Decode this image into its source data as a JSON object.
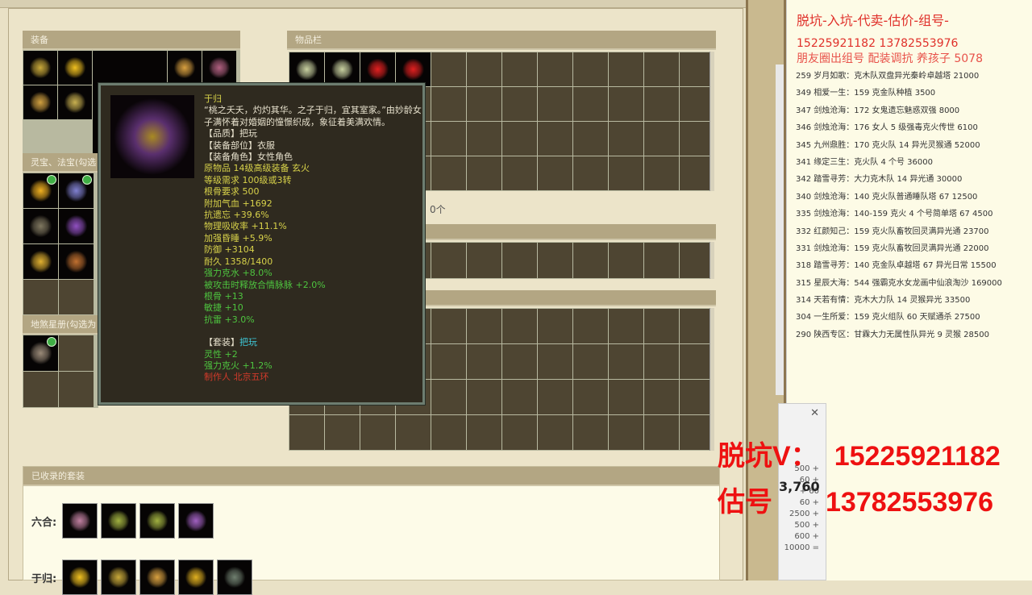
{
  "panels": {
    "equipment": "装备",
    "spirit_treasure": "灵宝、法宝(勾选",
    "star_book": "地煞星册(勾选为",
    "inventory": "物品栏",
    "count_text": "0个",
    "collected_sets": "已收录的套装"
  },
  "tooltip": {
    "name": "于归",
    "desc": "“桃之夭夭，灼灼其华。之子于归，宜其室家。”由妙龄女子满怀着对婚姻的憧憬织成，象征着美满欢情。",
    "quality": "【品质】把玩",
    "slot": "【装备部位】衣服",
    "role": "【装备角色】女性角色",
    "base_stats": [
      "原物品 14级高级装备 玄火",
      "等级需求 100级或3转",
      "根骨要求 500",
      "附加气血 +1692",
      "抗遗忘 +39.6%",
      "物理吸收率 +11.1%",
      "加强昏睡 +5.9%",
      "防御 +3104",
      "耐久 1358/1400"
    ],
    "extra_stats": [
      "强力克水 +8.0%",
      "被攻击时释放合情脉脉 +2.0%",
      "根骨 +13",
      "敏捷 +10",
      "抗雷 +3.0%"
    ],
    "set_label": "【套装】",
    "set_name": "把玩",
    "set_stats": [
      "灵性 +2",
      "强力克火 +1.2%"
    ],
    "maker": "制作人 北京五环"
  },
  "sets": [
    {
      "label": "六合:",
      "count": 4
    },
    {
      "label": "于归:",
      "count": 5
    }
  ],
  "doc": {
    "header": "脱坑-入坑-代卖-估价-组号-",
    "phones": "15225921182    13782553976",
    "promo": "朋友圈出组号   配装调抗  养孩子 5078",
    "lines": [
      "259 岁月如歌：克木队双盘异光秦岭卓越塔 21000",
      "349 相爱一生：159 克金队种植 3500",
      "347 剑烛沧海：172 女鬼遗忘魅惑双强 8000",
      "346 剑烛沧海：176 女人 5 级强毒克火传世 6100",
      "345 九州鼎胜：170 克火队 14 异光灵猴通 52000",
      "341 缘定三生：克火队 4 个号 36000",
      "342 踏雪寻芳：大力克木队 14 异光通 30000",
      "340 剑烛沧海：140 克火队普通睡队塔 67  12500",
      "335 剑烛沧海：140-159 克火 4 个号简单塔 67  4500",
      "332 红颜知己：159 克火队畜牧回灵满异光通 23700",
      "331 剑烛沧海：159 克火队畜牧回灵满异光通 22000",
      "318 踏雪寻芳：140 克金队卓越塔 67 异光日常 15500",
      "315 星辰大海：544 强霸克水女龙画中仙浪淘沙 169000",
      "314 天若有情：克木大力队 14 灵猴异光 33500",
      "304 一生所爱：159 克火组队 60 天赋通杀 27500",
      "290 陕西专区：甘霖大力无属性队异光 9 灵猴 28500"
    ]
  },
  "calc": {
    "close": "✕",
    "lines": [
      "500  +",
      "60  +",
      "+  60",
      "60  +",
      "2500  +",
      "500  +",
      "600  +",
      "10000 ="
    ],
    "result": "3,760"
  },
  "overlay": {
    "line1_label": "脱坑V：",
    "line1_value": "15225921182",
    "line2_label": "估号",
    "line2_value": "13782553976"
  }
}
